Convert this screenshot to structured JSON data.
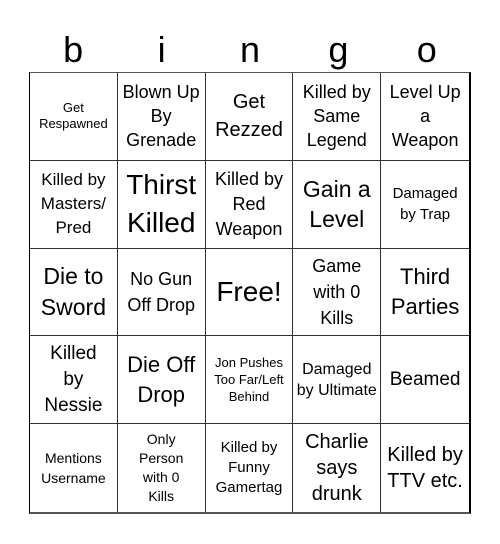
{
  "header": {
    "letters": [
      "b",
      "i",
      "n",
      "g",
      "o"
    ]
  },
  "cells": [
    "Get Respawned",
    "Blown Up By Grenade",
    "Get Rezzed",
    "Killed by Same Legend",
    "Level Up a Weapon",
    "Killed by Masters/ Pred",
    "Thirst Killed",
    "Killed by Red Weapon",
    "Gain a Level",
    "Damaged by Trap",
    "Die to Sword",
    "No Gun Off Drop",
    "Free!",
    "Game with 0 Kills",
    "Third Parties",
    "Killed by Nessie",
    "Die Off Drop",
    "Jon Pushes Too Far/Left Behind",
    "Damaged by Ultimate",
    "Beamed",
    "Mentions Username",
    "Only Person with 0 Kills",
    "Killed by Funny Gamertag",
    "Charlie says drunk",
    "Killed by TTV etc."
  ]
}
